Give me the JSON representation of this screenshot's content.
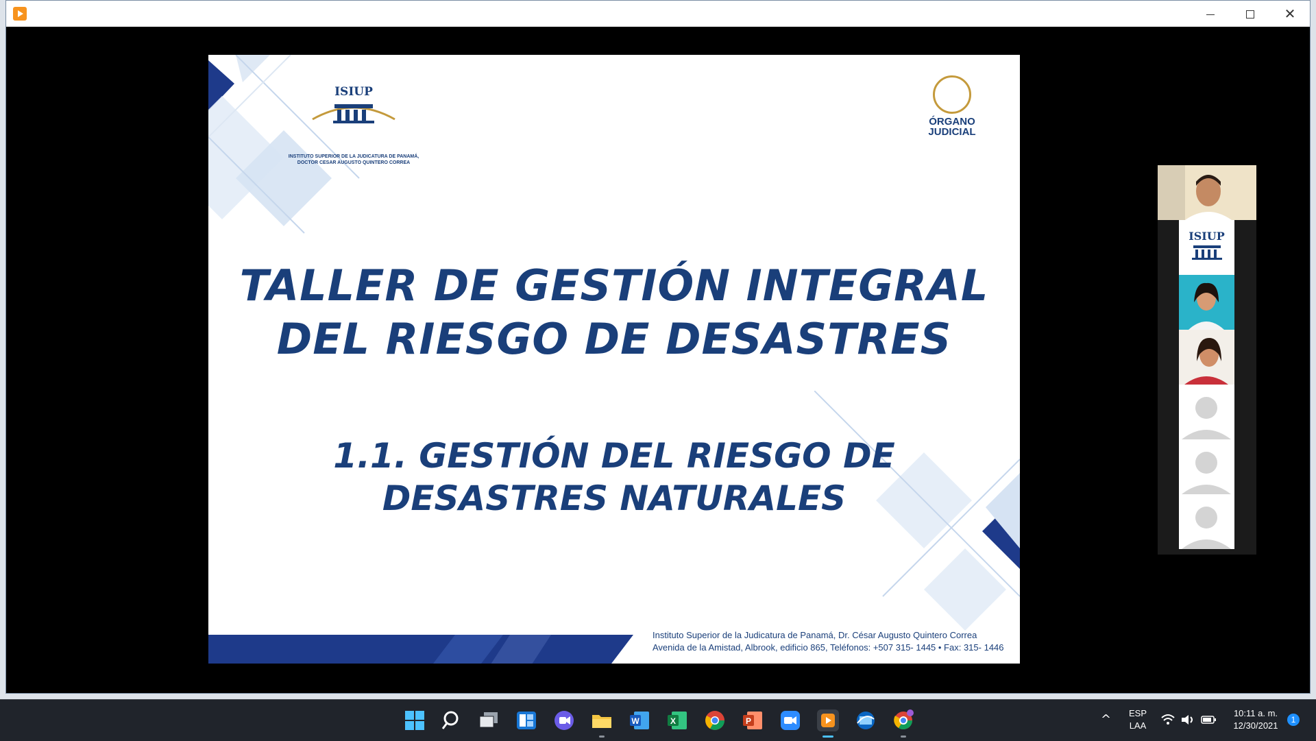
{
  "window": {
    "controls": {
      "minimize": "minimize",
      "maximize": "maximize",
      "close": "✕"
    }
  },
  "slide": {
    "title_line1": "TALLER DE GESTIÓN INTEGRAL",
    "title_line2": "DEL RIESGO DE DESASTRES",
    "subtitle_line1": "1.1. GESTIÓN DEL RIESGO DE",
    "subtitle_line2": "DESASTRES NATURALES",
    "logo_left": {
      "word": "ISIUP",
      "caption_line1": "INSTITUTO SUPERIOR DE LA JUDICATURA DE PANAMÁ,",
      "caption_line2": "DOCTOR CESAR AUGUSTO QUINTERO CORREA"
    },
    "logo_right": {
      "line1": "ÓRGANO",
      "line2": "JUDICIAL"
    },
    "footer_line1": "Instituto Superior de la Judicatura de Panamá, Dr. César Augusto Quintero Correa",
    "footer_line2": "Avenida de la Amistad, Albrook, edificio 865, Teléfonos: +507 315- 1445 • Fax: 315- 1446",
    "accent_color": "#1a3f7a"
  },
  "participants": {
    "logo_tile_word": "ISIUP",
    "tiles": [
      "speaker-video",
      "isiup-logo",
      "participant-video",
      "participant-video",
      "avatar-placeholder",
      "avatar-placeholder",
      "avatar-placeholder"
    ]
  },
  "taskbar": {
    "apps": [
      "start-icon",
      "search-icon",
      "task-view-icon",
      "widgets-icon",
      "teams-chat-icon",
      "file-explorer-icon",
      "word-icon",
      "excel-icon",
      "chrome-icon",
      "powerpoint-icon",
      "zoom-icon",
      "media-player-icon",
      "remote-desktop-icon",
      "chrome-profile-icon"
    ],
    "tray": {
      "language_line1": "ESP",
      "language_line2": "LAA",
      "time": "10:11 a. m.",
      "date": "12/30/2021",
      "notification_count": "1"
    }
  }
}
